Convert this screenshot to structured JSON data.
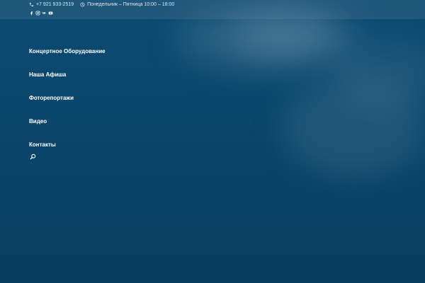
{
  "topbar": {
    "phone": "+7 921 933-2519",
    "hours": "Понедельник – Пятница 10:00 – 18:00"
  },
  "social": [
    {
      "icon": "facebook-icon"
    },
    {
      "icon": "instagram-icon"
    },
    {
      "icon": "vk-icon"
    },
    {
      "icon": "youtube-icon"
    }
  ],
  "nav": {
    "items": [
      {
        "label": "Концертное Оборудование"
      },
      {
        "label": "Наша Афиша"
      },
      {
        "label": "Фоторепортажи"
      },
      {
        "label": "Видео"
      },
      {
        "label": "Контакты"
      }
    ]
  },
  "search": {
    "icon": "search-icon"
  },
  "colors": {
    "background": "#0b466c",
    "text": "#ffffff",
    "muted_text": "#d9e6ee"
  }
}
